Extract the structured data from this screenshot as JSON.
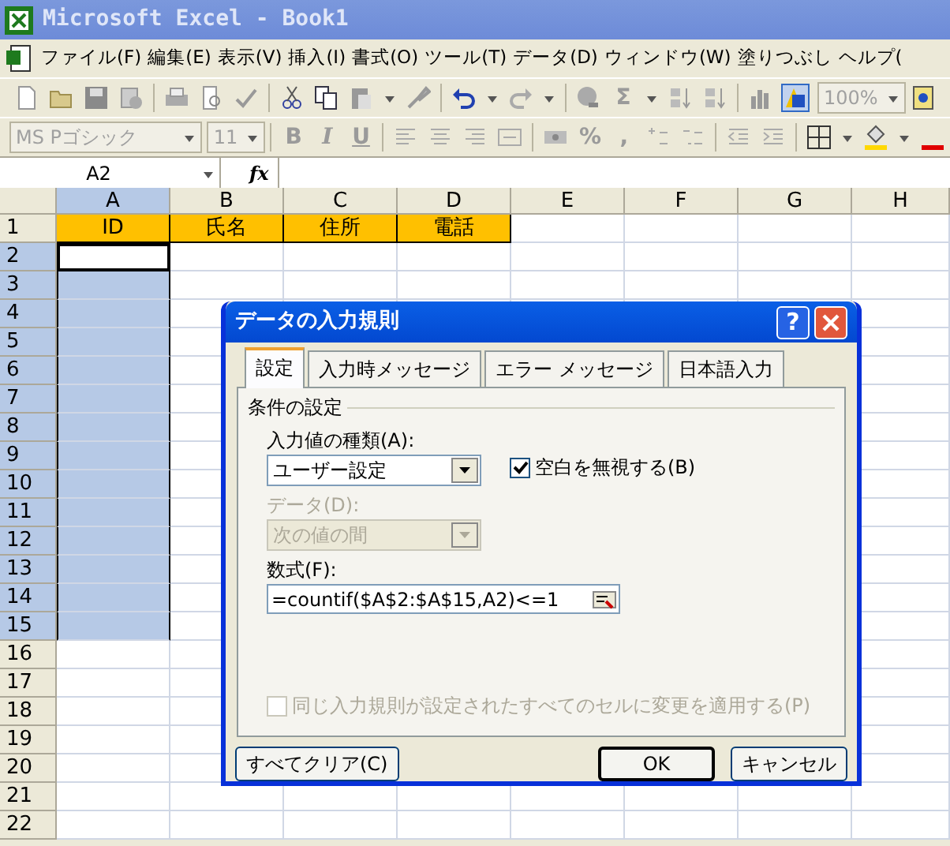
{
  "window": {
    "title": "Microsoft Excel - Book1"
  },
  "menu": [
    {
      "label": "ファイル(F)"
    },
    {
      "label": "編集(E)"
    },
    {
      "label": "表示(V)"
    },
    {
      "label": "挿入(I)"
    },
    {
      "label": "書式(O)"
    },
    {
      "label": "ツール(T)"
    },
    {
      "label": "データ(D)"
    },
    {
      "label": "ウィンドウ(W)"
    },
    {
      "label": "塗りつぶし"
    },
    {
      "label": "ヘルプ("
    }
  ],
  "standard_toolbar": {
    "sum_glyph": "Σ",
    "zoom": "100%"
  },
  "format_toolbar": {
    "font": "MS Pゴシック",
    "size": "11",
    "bold": "B",
    "italic": "I",
    "underline": "U",
    "percent": "%",
    "comma": ","
  },
  "formula_bar": {
    "name_box": "A2",
    "fx": "fx"
  },
  "sheet": {
    "columns": [
      {
        "label": "A",
        "selected": true
      },
      {
        "label": "B",
        "selected": false
      },
      {
        "label": "C",
        "selected": false
      },
      {
        "label": "D",
        "selected": false
      },
      {
        "label": "E",
        "selected": false
      },
      {
        "label": "F",
        "selected": false
      },
      {
        "label": "G",
        "selected": false
      },
      {
        "label": "H",
        "selected": false
      }
    ],
    "rows": [
      {
        "label": "1",
        "selected": false,
        "active": false,
        "cells": [
          {
            "text": "ID",
            "kind": "header"
          },
          {
            "text": "氏名",
            "kind": "header"
          },
          {
            "text": "住所",
            "kind": "header"
          },
          {
            "text": "電話",
            "kind": "header"
          }
        ]
      },
      {
        "label": "2",
        "selected": true,
        "active": true
      },
      {
        "label": "3",
        "selected": true,
        "active": false
      },
      {
        "label": "4",
        "selected": true,
        "active": false
      },
      {
        "label": "5",
        "selected": true,
        "active": false
      },
      {
        "label": "6",
        "selected": true,
        "active": false
      },
      {
        "label": "7",
        "selected": true,
        "active": false
      },
      {
        "label": "8",
        "selected": true,
        "active": false
      },
      {
        "label": "9",
        "selected": true,
        "active": false
      },
      {
        "label": "10",
        "selected": true,
        "active": false
      },
      {
        "label": "11",
        "selected": true,
        "active": false
      },
      {
        "label": "12",
        "selected": true,
        "active": false
      },
      {
        "label": "13",
        "selected": true,
        "active": false
      },
      {
        "label": "14",
        "selected": true,
        "active": false
      },
      {
        "label": "15",
        "selected": true,
        "active": false
      },
      {
        "label": "16",
        "selected": false,
        "active": false
      },
      {
        "label": "17",
        "selected": false,
        "active": false
      },
      {
        "label": "18",
        "selected": false,
        "active": false
      },
      {
        "label": "19",
        "selected": false,
        "active": false
      },
      {
        "label": "20",
        "selected": false,
        "active": false
      },
      {
        "label": "21",
        "selected": false,
        "active": false
      },
      {
        "label": "22",
        "selected": false,
        "active": false
      }
    ]
  },
  "dialog": {
    "title": "データの入力規則",
    "help_glyph": "?",
    "tabs": [
      {
        "label": "設定",
        "selected": true
      },
      {
        "label": "入力時メッセージ",
        "selected": false
      },
      {
        "label": "エラー メッセージ",
        "selected": false
      },
      {
        "label": "日本語入力",
        "selected": false
      }
    ],
    "group_label": "条件の設定",
    "allow": {
      "label": "入力値の種類(A):",
      "value": "ユーザー設定",
      "disabled": false
    },
    "ignore_blank": {
      "label": "空白を無視する(B)",
      "checked": true,
      "disabled": false
    },
    "data": {
      "label": "データ(D):",
      "value": "次の値の間",
      "disabled": true
    },
    "formula": {
      "label": "数式(F):",
      "value": "=countif($A$2:$A$15,A2)<=1"
    },
    "apply_all": {
      "label": "同じ入力規則が設定されたすべてのセルに変更を適用する(P)",
      "checked": false,
      "disabled": true
    },
    "buttons": [
      {
        "label": "すべてクリア(C)",
        "default": false
      },
      {
        "label": "OK",
        "default": true
      },
      {
        "label": "キャンセル",
        "default": false
      }
    ]
  }
}
